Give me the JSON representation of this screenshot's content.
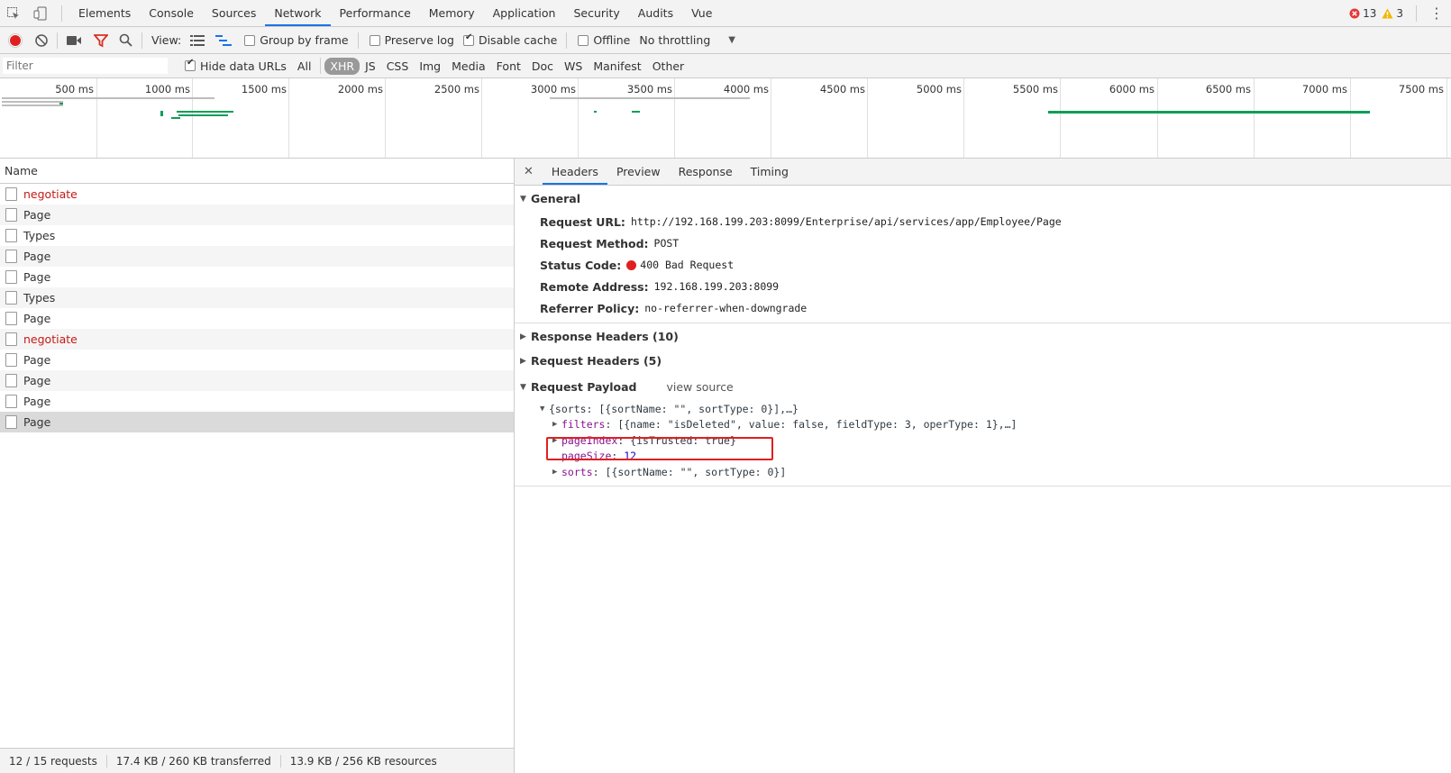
{
  "tabbar": {
    "tabs": [
      "Elements",
      "Console",
      "Sources",
      "Network",
      "Performance",
      "Memory",
      "Application",
      "Security",
      "Audits",
      "Vue"
    ],
    "active_tab": "Network",
    "errors": "13",
    "warnings": "3"
  },
  "toolbar": {
    "view_label": "View:",
    "group_by_frame": "Group by frame",
    "preserve_log": "Preserve log",
    "disable_cache": "Disable cache",
    "offline": "Offline",
    "throttling": "No throttling"
  },
  "filterbar": {
    "placeholder": "Filter",
    "hide_data_urls": "Hide data URLs",
    "types": [
      "All",
      "XHR",
      "JS",
      "CSS",
      "Img",
      "Media",
      "Font",
      "Doc",
      "WS",
      "Manifest",
      "Other"
    ],
    "active_type": "XHR"
  },
  "overview": {
    "ticks": [
      "500 ms",
      "1000 ms",
      "1500 ms",
      "2000 ms",
      "2500 ms",
      "3000 ms",
      "3500 ms",
      "4000 ms",
      "4500 ms",
      "5000 ms",
      "5500 ms",
      "6000 ms",
      "6500 ms",
      "7000 ms",
      "7500 ms"
    ]
  },
  "request_list": {
    "header": "Name",
    "rows": [
      {
        "name": "negotiate",
        "error": true
      },
      {
        "name": "Page",
        "error": false
      },
      {
        "name": "Types",
        "error": false
      },
      {
        "name": "Page",
        "error": false
      },
      {
        "name": "Page",
        "error": false
      },
      {
        "name": "Types",
        "error": false
      },
      {
        "name": "Page",
        "error": false
      },
      {
        "name": "negotiate",
        "error": true
      },
      {
        "name": "Page",
        "error": false
      },
      {
        "name": "Page",
        "error": false
      },
      {
        "name": "Page",
        "error": false
      },
      {
        "name": "Page",
        "error": false,
        "selected": true
      }
    ]
  },
  "details": {
    "tabs": [
      "Headers",
      "Preview",
      "Response",
      "Timing"
    ],
    "active_tab": "Headers",
    "general": {
      "title": "General",
      "request_url_label": "Request URL:",
      "request_url": "http://192.168.199.203:8099/Enterprise/api/services/app/Employee/Page",
      "request_method_label": "Request Method:",
      "request_method": "POST",
      "status_code_label": "Status Code:",
      "status_code": "400 Bad Request",
      "remote_address_label": "Remote Address:",
      "remote_address": "192.168.199.203:8099",
      "referrer_policy_label": "Referrer Policy:",
      "referrer_policy": "no-referrer-when-downgrade"
    },
    "response_headers": "Response Headers (10)",
    "request_headers": "Request Headers (5)",
    "request_payload": {
      "title": "Request Payload",
      "view_source": "view source",
      "root": "{sorts: [{sortName: \"\", sortType: 0}],…}",
      "filters_key": "filters",
      "filters_value": "[{name: \"isDeleted\", value: false, fieldType: 3, operType: 1},…]",
      "pageindex_key": "pageIndex",
      "pageindex_value": "{isTrusted: true}",
      "pagesize_key": "pageSize",
      "pagesize_value": "12",
      "sorts_key": "sorts",
      "sorts_value": "[{sortName: \"\", sortType: 0}]"
    }
  },
  "status": {
    "requests": "12 / 15 requests",
    "transferred": "17.4 KB / 260 KB transferred",
    "resources": "13.9 KB / 256 KB resources"
  },
  "colors": {
    "error": "#c41a16",
    "accent": "#1a73e8",
    "timeline_green": "#0f9d58",
    "highlight": "#e02020"
  }
}
